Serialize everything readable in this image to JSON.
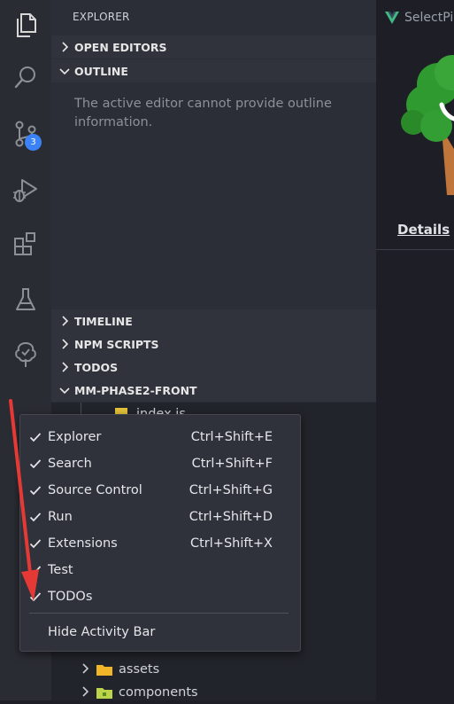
{
  "activity_bar": {
    "items": [
      {
        "icon": "files-icon",
        "name": "Explorer"
      },
      {
        "icon": "search-icon",
        "name": "Search"
      },
      {
        "icon": "source-control-icon",
        "name": "Source Control",
        "badge": "3"
      },
      {
        "icon": "run-debug-icon",
        "name": "Run"
      },
      {
        "icon": "extensions-icon",
        "name": "Extensions"
      },
      {
        "icon": "flask-icon",
        "name": "Test"
      },
      {
        "icon": "todo-tree-icon",
        "name": "TODOs"
      }
    ],
    "accent_color": "#3b82f6"
  },
  "sidebar": {
    "title": "EXPLORER",
    "sections": {
      "open_editors": "OPEN EDITORS",
      "outline": "OUTLINE",
      "timeline": "TIMELINE",
      "npm_scripts": "NPM SCRIPTS",
      "todos": "TODOS",
      "project": "MM-PHASE2-FRONT"
    },
    "outline_message": "The active editor cannot provide outline information.",
    "tree": {
      "top_file": "index.js",
      "items": [
        {
          "label": "assets",
          "type": "folder"
        },
        {
          "label": "components",
          "type": "folder"
        }
      ]
    }
  },
  "editor": {
    "tab_title": "SelectPi",
    "details_link": "Details"
  },
  "context_menu": {
    "items": [
      {
        "label": "Explorer",
        "shortcut": "Ctrl+Shift+E",
        "checked": true
      },
      {
        "label": "Search",
        "shortcut": "Ctrl+Shift+F",
        "checked": true
      },
      {
        "label": "Source Control",
        "shortcut": "Ctrl+Shift+G",
        "checked": true
      },
      {
        "label": "Run",
        "shortcut": "Ctrl+Shift+D",
        "checked": true
      },
      {
        "label": "Extensions",
        "shortcut": "Ctrl+Shift+X",
        "checked": true
      },
      {
        "label": "Test",
        "shortcut": "",
        "checked": true
      },
      {
        "label": "TODOs",
        "shortcut": "",
        "checked": true
      }
    ],
    "hide_label": "Hide Activity Bar"
  },
  "annotation": {
    "arrow_color": "#e53935"
  }
}
